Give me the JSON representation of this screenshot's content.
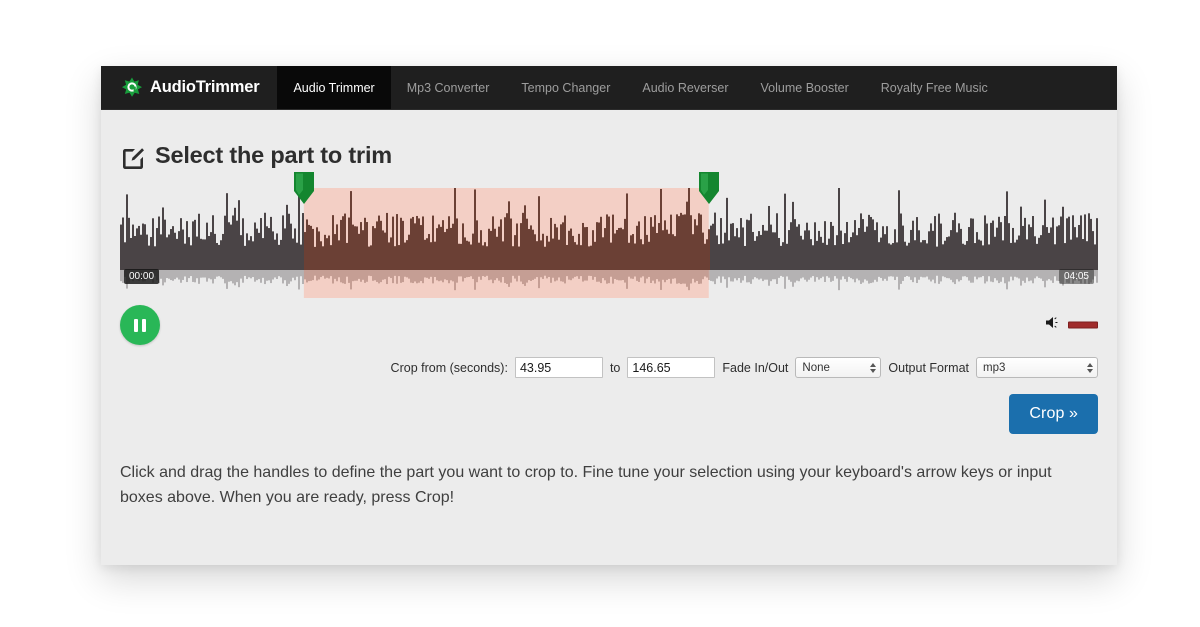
{
  "site": {
    "brand_name": "AudioTrimmer",
    "brand_icon": "audio-burst-logo-icon"
  },
  "nav": {
    "items": [
      {
        "label": "Audio Trimmer",
        "active": true
      },
      {
        "label": "Mp3 Converter",
        "active": false
      },
      {
        "label": "Tempo Changer",
        "active": false
      },
      {
        "label": "Audio Reverser",
        "active": false
      },
      {
        "label": "Volume Booster",
        "active": false
      },
      {
        "label": "Royalty Free Music",
        "active": false
      }
    ]
  },
  "heading": {
    "icon": "edit-square-icon",
    "title": "Select the part to trim"
  },
  "waveform": {
    "start_time_label": "00:00",
    "end_time_label": "04:05",
    "selection_start_pct": 18.8,
    "selection_end_pct": 60.2,
    "handle_icon": "selection-handle-icon",
    "colors": {
      "wave_unselected": "#4a4446",
      "wave_selected": "#6b4035",
      "selection_overlay": "#f3cfc5",
      "background": "#ececec"
    }
  },
  "transport": {
    "play_pause_label": "pause",
    "play_pause_icon": "pause-icon",
    "volume_icon": "speaker-icon",
    "volume_level_pct": 100
  },
  "options": {
    "crop_from_label": "Crop from (seconds):",
    "crop_from_value": "43.95",
    "to_label": "to",
    "crop_to_value": "146.65",
    "fade_label": "Fade In/Out",
    "fade_value": "None",
    "format_label": "Output Format",
    "format_value": "mp3"
  },
  "action": {
    "crop_button_label": "Crop »"
  },
  "help": {
    "text": "Click and drag the handles to define the part you want to crop to. Fine tune your selection using your keyboard's arrow keys or input boxes above. When you are ready, press Crop!"
  },
  "theme": {
    "accent_green": "#29b757",
    "accent_blue": "#1b6fad",
    "nav_background": "#1f1f1f",
    "panel_background": "#ececec"
  }
}
